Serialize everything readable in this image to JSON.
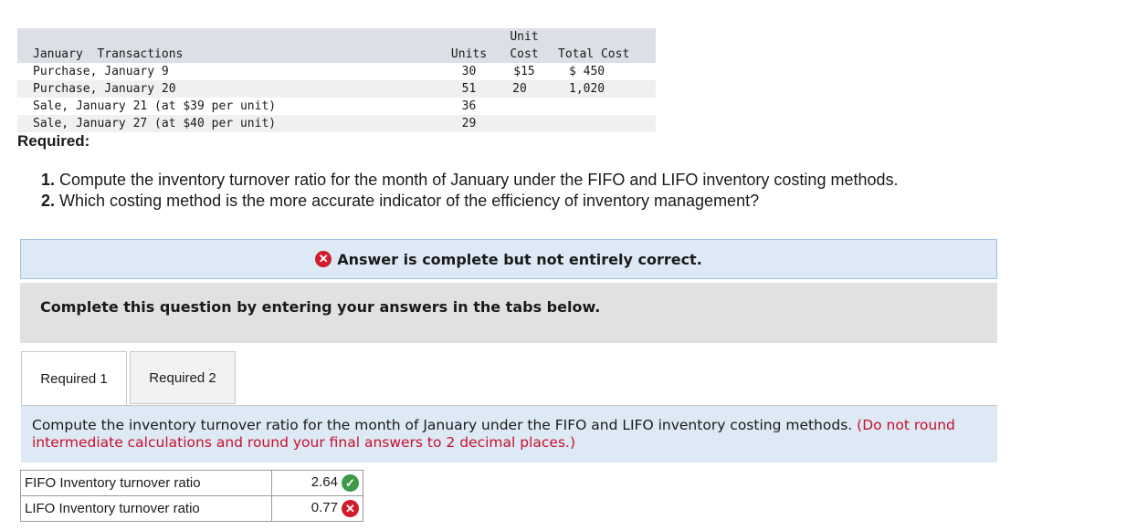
{
  "transactions": {
    "header": {
      "unit_top": "Unit",
      "label": "January  Transactions",
      "units": "Units",
      "cost": "Cost",
      "total": "Total Cost"
    },
    "rows": [
      {
        "label": "Purchase, January 9",
        "units": "30",
        "cost": "$15",
        "total": "$ 450"
      },
      {
        "label": "Purchase, January 20",
        "units": "51",
        "cost": "20",
        "total": "1,020"
      },
      {
        "label": "Sale, January 21 (at $39 per unit)",
        "units": "36",
        "cost": "",
        "total": ""
      },
      {
        "label": "Sale, January 27 (at $40 per unit)",
        "units": "29",
        "cost": "",
        "total": ""
      }
    ]
  },
  "required_heading": "Required:",
  "questions": [
    {
      "num": "1.",
      "text": "Compute the inventory turnover ratio for the month of January under the FIFO and LIFO inventory costing methods."
    },
    {
      "num": "2.",
      "text": "Which costing method is the more accurate indicator of the efficiency of inventory management?"
    }
  ],
  "status": {
    "text": "Answer is complete but not entirely correct.",
    "icon": "x-circle-icon",
    "color": "#d11c2c"
  },
  "instruction": "Complete this question by entering your answers in the tabs below.",
  "tabs": [
    {
      "label": "Required 1",
      "active": true
    },
    {
      "label": "Required 2",
      "active": false
    }
  ],
  "prompt": {
    "text": "Compute the inventory turnover ratio for the month of January under the FIFO and LIFO inventory costing methods.",
    "note": "(Do not round intermediate calculations and round your final answers to 2 decimal places.)"
  },
  "answers": [
    {
      "label": "FIFO Inventory turnover ratio",
      "value": "2.64",
      "result": "correct",
      "icon": "check-circle-icon"
    },
    {
      "label": "LIFO Inventory turnover ratio",
      "value": "0.77",
      "result": "incorrect",
      "icon": "x-circle-icon"
    }
  ]
}
